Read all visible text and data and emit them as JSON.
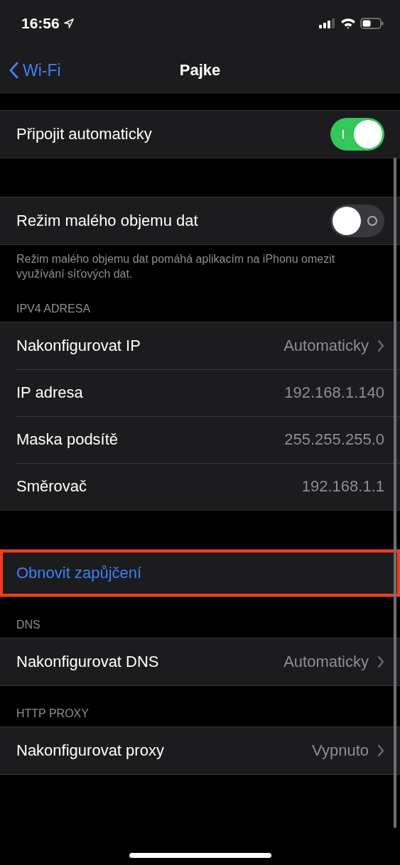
{
  "status_bar": {
    "time": "16:56"
  },
  "nav": {
    "back": "Wi-Fi",
    "title": "Pajke"
  },
  "sections": [
    {
      "items": [
        {
          "kind": "toggle",
          "label": "Připojit automaticky",
          "on": true
        }
      ]
    },
    {
      "items": [
        {
          "kind": "toggle",
          "label": "Režim malého objemu dat",
          "on": false
        }
      ],
      "footer": "Režim malého objemu dat pomáhá aplikacím na iPhonu omezit využívání síťových dat."
    },
    {
      "header": "IPV4 ADRESA",
      "items": [
        {
          "kind": "link",
          "label": "Nakonfigurovat IP",
          "value": "Automaticky"
        },
        {
          "kind": "value",
          "label": "IP adresa",
          "value": "192.168.1.140"
        },
        {
          "kind": "value",
          "label": "Maska podsítě",
          "value": "255.255.255.0"
        },
        {
          "kind": "value",
          "label": "Směrovač",
          "value": "192.168.1.1"
        }
      ]
    },
    {
      "items": [
        {
          "kind": "action",
          "label": "Obnovit zapůjčení",
          "highlighted": true
        }
      ]
    },
    {
      "header": "DNS",
      "items": [
        {
          "kind": "link",
          "label": "Nakonfigurovat DNS",
          "value": "Automaticky"
        }
      ]
    },
    {
      "header": "HTTP PROXY",
      "items": [
        {
          "kind": "link",
          "label": "Nakonfigurovat proxy",
          "value": "Vypnuto"
        }
      ]
    }
  ]
}
